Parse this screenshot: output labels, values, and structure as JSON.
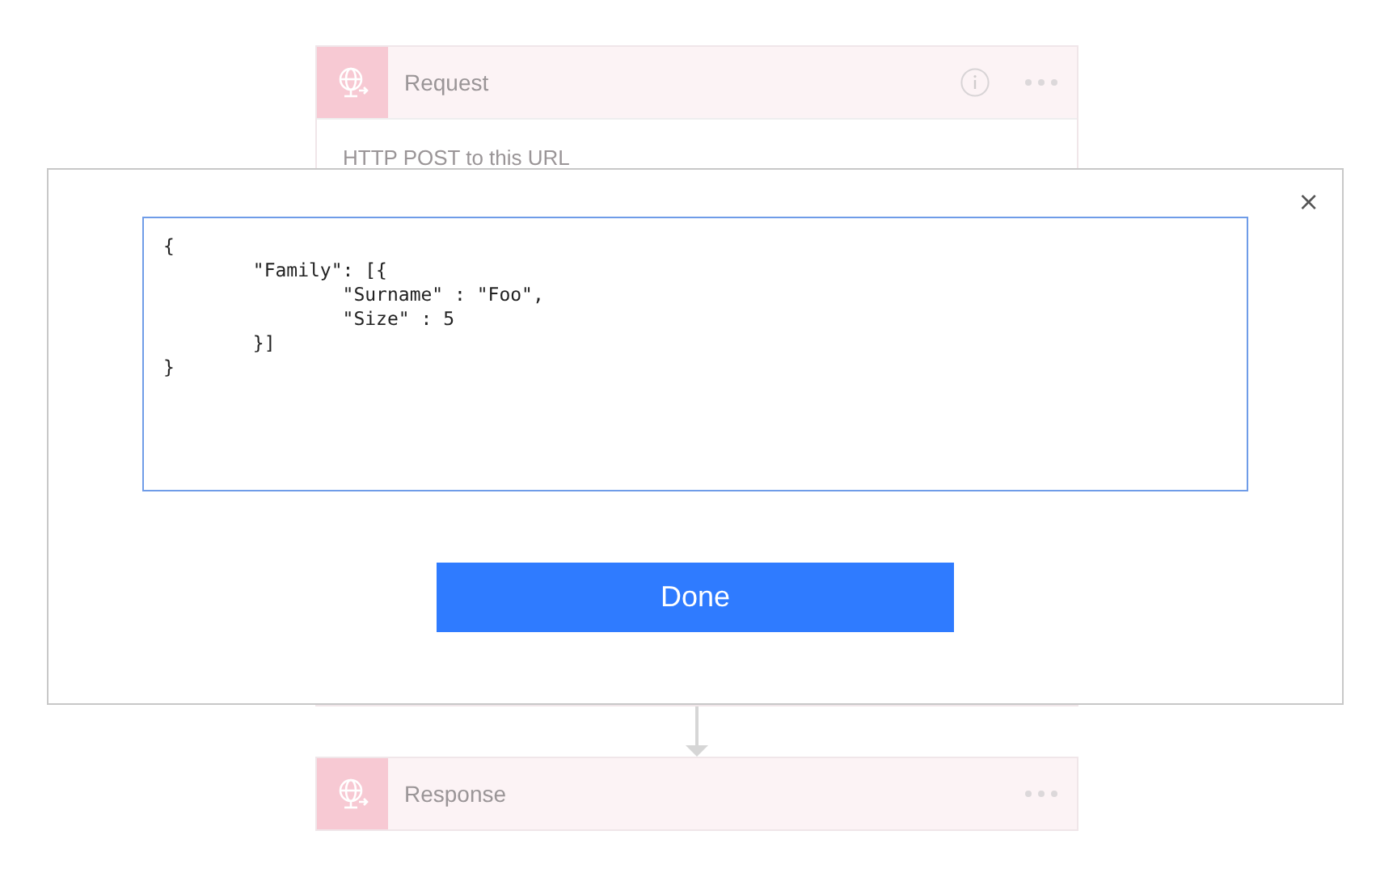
{
  "background_flow": [
    {
      "kind": "trigger",
      "title": "Request",
      "description": "HTTP POST to this URL",
      "info": true
    },
    {
      "kind": "action",
      "title": "Response",
      "info": false
    }
  ],
  "dialog": {
    "close_label": "×",
    "editor_value": "{\n\t\"Family\": [{\n\t\t\"Surname\" : \"Foo\",\n\t\t\"Size\" : 5\n\t}]\n}",
    "button": "Done"
  }
}
